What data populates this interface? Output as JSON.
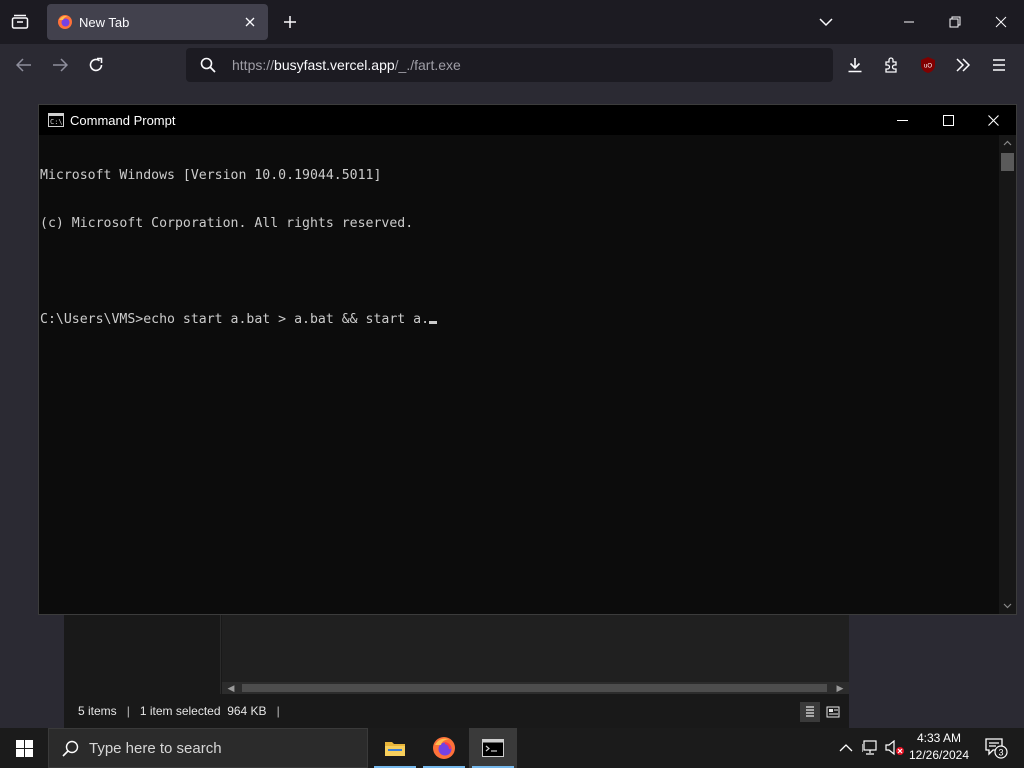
{
  "browser": {
    "tab": {
      "title": "New Tab"
    },
    "url": {
      "prefix": "https://",
      "host": "busyfast.vercel.app",
      "path": "/_./fart.exe"
    },
    "accent": "#ff4f5e"
  },
  "explorer": {
    "status": {
      "items": "5 items",
      "sep1": "|",
      "selected": "1 item selected  964 KB",
      "sep2": "|"
    }
  },
  "cmd": {
    "title": "Command Prompt",
    "lines": [
      "Microsoft Windows [Version 10.0.19044.5011]",
      "(c) Microsoft Corporation. All rights reserved.",
      "",
      "C:\\Users\\VMS>echo start a.bat > a.bat && start a."
    ]
  },
  "taskbar": {
    "search_placeholder": "Type here to search",
    "clock": {
      "time": "4:33 AM",
      "date": "12/26/2024"
    },
    "notifications_count": "3"
  }
}
